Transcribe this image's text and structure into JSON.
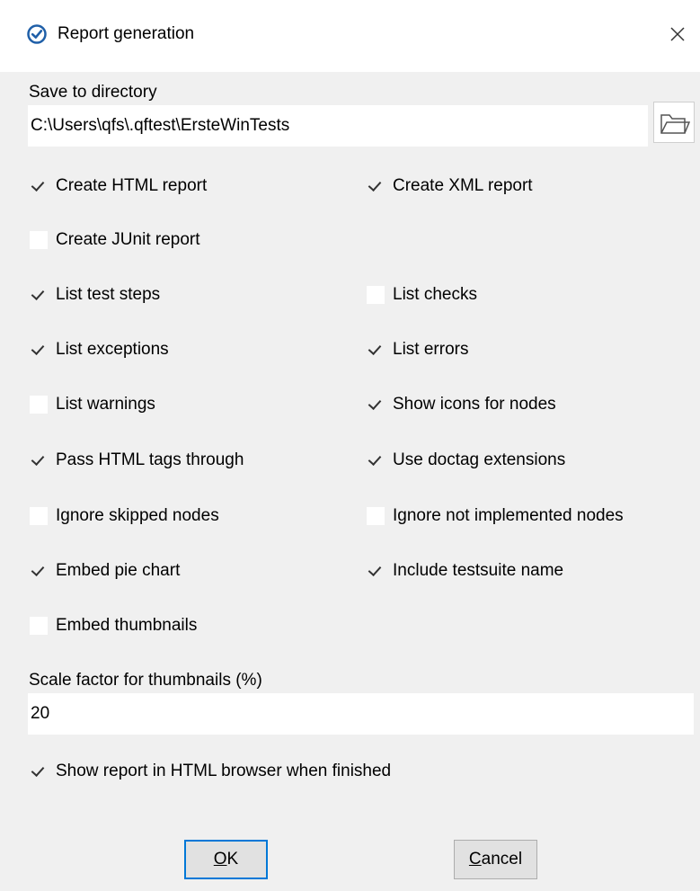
{
  "window": {
    "title": "Report generation"
  },
  "directory": {
    "label": "Save to directory",
    "value": "C:\\Users\\qfs\\.qftest\\ErsteWinTests"
  },
  "options": {
    "html_report": {
      "label": "Create HTML report",
      "checked": true
    },
    "xml_report": {
      "label": "Create XML report",
      "checked": true
    },
    "junit_report": {
      "label": "Create JUnit report",
      "checked": false
    },
    "list_test_steps": {
      "label": "List test steps",
      "checked": true
    },
    "list_checks": {
      "label": "List checks",
      "checked": false
    },
    "list_exceptions": {
      "label": "List exceptions",
      "checked": true
    },
    "list_errors": {
      "label": "List errors",
      "checked": true
    },
    "list_warnings": {
      "label": "List warnings",
      "checked": false
    },
    "show_icons": {
      "label": "Show icons for nodes",
      "checked": true
    },
    "pass_html": {
      "label": "Pass HTML tags through",
      "checked": true
    },
    "doctag": {
      "label": "Use doctag extensions",
      "checked": true
    },
    "ignore_skipped": {
      "label": "Ignore skipped nodes",
      "checked": false
    },
    "ignore_not_impl": {
      "label": "Ignore not implemented nodes",
      "checked": false
    },
    "embed_pie": {
      "label": "Embed pie chart",
      "checked": true
    },
    "include_suite_name": {
      "label": "Include testsuite name",
      "checked": true
    },
    "embed_thumbnails": {
      "label": "Embed thumbnails",
      "checked": false
    },
    "show_in_browser": {
      "label": "Show report in HTML browser when finished",
      "checked": true
    }
  },
  "scale": {
    "label": "Scale factor for thumbnails (%)",
    "value": "20"
  },
  "buttons": {
    "ok": {
      "mnemonic": "O",
      "rest": "K"
    },
    "cancel": {
      "mnemonic": "C",
      "rest": "ancel"
    }
  },
  "icons": {
    "app": "check-circle-icon",
    "close": "close-icon",
    "browse": "folder-open-icon"
  },
  "colors": {
    "accent": "#0078d7",
    "icon_blue": "#1f5fa8",
    "dialog_bg": "#f0f0f0"
  }
}
